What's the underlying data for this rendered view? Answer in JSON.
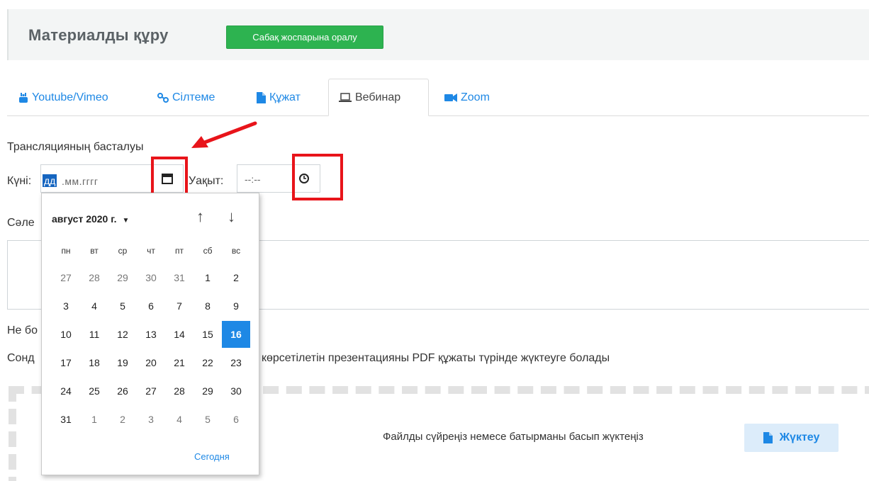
{
  "header": {
    "title": "Материалды құру",
    "back_button": "Сабақ жоспарына оралу"
  },
  "tabs": [
    {
      "label": "Youtube/Vimeo",
      "icon": "youtube-icon"
    },
    {
      "label": "Сілтеме",
      "icon": "link-icon"
    },
    {
      "label": "Құжат",
      "icon": "file-icon"
    },
    {
      "label": "Вебинар",
      "icon": "laptop-icon"
    },
    {
      "label": "Zoom",
      "icon": "video-camera-icon"
    }
  ],
  "active_tab": "Вебинар",
  "form": {
    "start_label": "Трансляцияның басталуы",
    "date_label": "Күні:",
    "date_placeholder_selected": "дд",
    "date_placeholder_rest": ".мм.гггг",
    "time_label": "Уақыт:",
    "time_placeholder": "--:--",
    "partial_label_1": "Сәле",
    "partial_label_2": "Не бо",
    "partial_text_start": "Сонд",
    "presentation_text": "көрсетілетін презентацияны PDF құжаты түрінде жүктеуге болады",
    "dropzone_text": "Файлды сүйреңіз немесе батырманы басып жүктеңіз",
    "upload_button": "Жүктеу"
  },
  "calendar": {
    "month_label": "август 2020 г.",
    "weekdays": [
      "пн",
      "вт",
      "ср",
      "чт",
      "пт",
      "сб",
      "вс"
    ],
    "weeks": [
      [
        "27",
        "28",
        "29",
        "30",
        "31",
        "1",
        "2"
      ],
      [
        "3",
        "4",
        "5",
        "6",
        "7",
        "8",
        "9"
      ],
      [
        "10",
        "11",
        "12",
        "13",
        "14",
        "15",
        "16"
      ],
      [
        "17",
        "18",
        "19",
        "20",
        "21",
        "22",
        "23"
      ],
      [
        "24",
        "25",
        "26",
        "27",
        "28",
        "29",
        "30"
      ],
      [
        "31",
        "1",
        "2",
        "3",
        "4",
        "5",
        "6"
      ]
    ],
    "today": "16",
    "today_link": "Сегодня"
  },
  "colors": {
    "accent_blue": "#1e88e5",
    "green_button": "#2db350",
    "highlight_red": "#e8141a"
  }
}
